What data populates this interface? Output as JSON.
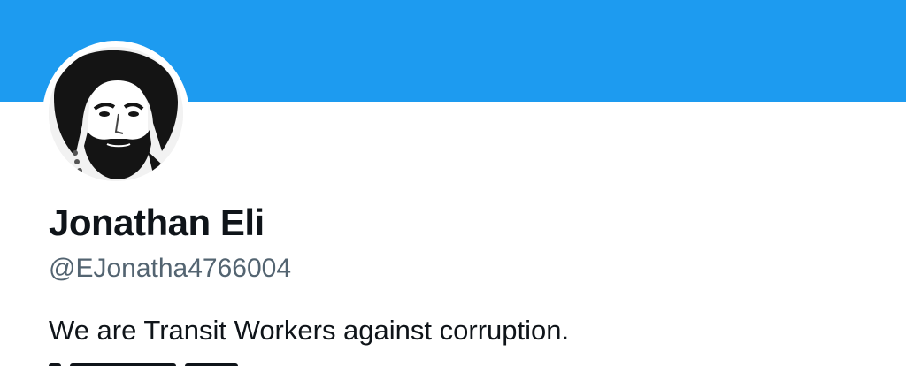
{
  "profile": {
    "banner_color": "#1d9bf0",
    "avatar": "profile-photo",
    "display_name": "Jonathan Eli",
    "handle": "@EJonatha4766004",
    "bio": "We are Transit Workers against corruption."
  },
  "colors": {
    "name": "#0f1419",
    "handle": "#536471",
    "background": "#ffffff"
  }
}
